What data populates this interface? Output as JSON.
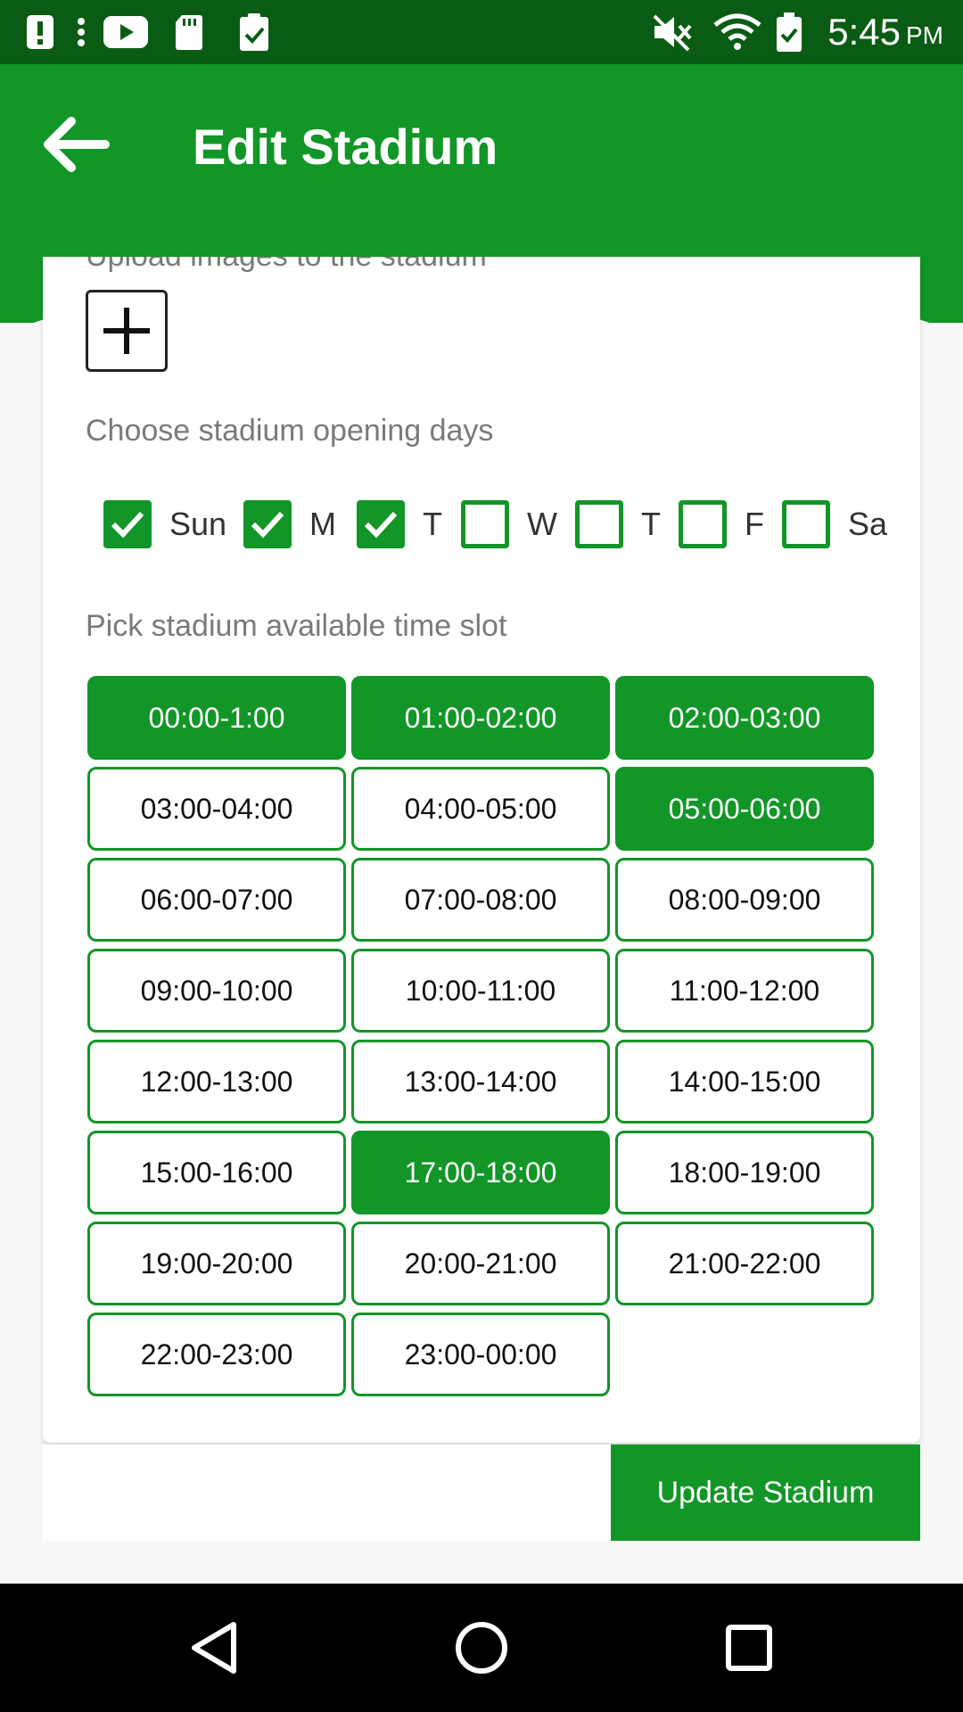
{
  "status_bar": {
    "time": "5:45",
    "ampm": "PM",
    "icons": [
      "alert-icon",
      "more-icon",
      "youtube-icon",
      "sd-card-icon",
      "clipboard-check-icon",
      "mute-icon",
      "wifi-icon",
      "battery-icon"
    ]
  },
  "header": {
    "title": "Edit Stadium",
    "back_icon": "arrow-left-icon"
  },
  "form": {
    "upload_label": "Upload images to the stadium",
    "add_image_icon": "plus-icon",
    "days_label": "Choose stadium opening days",
    "days": [
      {
        "label": "Sun",
        "checked": true
      },
      {
        "label": "M",
        "checked": true
      },
      {
        "label": "T",
        "checked": true
      },
      {
        "label": "W",
        "checked": false
      },
      {
        "label": "T",
        "checked": false
      },
      {
        "label": "F",
        "checked": false
      },
      {
        "label": "Sa",
        "checked": false
      }
    ],
    "slots_label": "Pick stadium available time slot",
    "slots": [
      {
        "label": "00:00-1:00",
        "selected": true
      },
      {
        "label": "01:00-02:00",
        "selected": true
      },
      {
        "label": "02:00-03:00",
        "selected": true
      },
      {
        "label": "03:00-04:00",
        "selected": false
      },
      {
        "label": "04:00-05:00",
        "selected": false
      },
      {
        "label": "05:00-06:00",
        "selected": true
      },
      {
        "label": "06:00-07:00",
        "selected": false
      },
      {
        "label": "07:00-08:00",
        "selected": false
      },
      {
        "label": "08:00-09:00",
        "selected": false
      },
      {
        "label": "09:00-10:00",
        "selected": false
      },
      {
        "label": "10:00-11:00",
        "selected": false
      },
      {
        "label": "11:00-12:00",
        "selected": false
      },
      {
        "label": "12:00-13:00",
        "selected": false
      },
      {
        "label": "13:00-14:00",
        "selected": false
      },
      {
        "label": "14:00-15:00",
        "selected": false
      },
      {
        "label": "15:00-16:00",
        "selected": false
      },
      {
        "label": "17:00-18:00",
        "selected": true
      },
      {
        "label": "18:00-19:00",
        "selected": false
      },
      {
        "label": "19:00-20:00",
        "selected": false
      },
      {
        "label": "20:00-21:00",
        "selected": false
      },
      {
        "label": "21:00-22:00",
        "selected": false
      },
      {
        "label": "22:00-23:00",
        "selected": false
      },
      {
        "label": "23:00-00:00",
        "selected": false
      }
    ],
    "submit_label": "Update Stadium"
  },
  "nav_bar": {
    "icons": [
      "back-triangle-icon",
      "home-circle-icon",
      "recents-square-icon"
    ]
  },
  "colors": {
    "primary": "#129627",
    "status_bar": "#0a5c14",
    "label_gray": "#7a7a7a"
  }
}
